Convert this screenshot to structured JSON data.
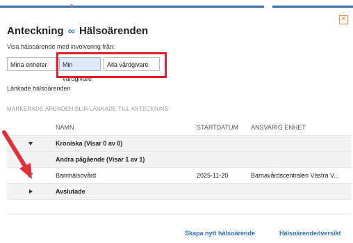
{
  "dialog": {
    "title_left": "Anteckning",
    "title_right": "Hälsoärenden",
    "close_symbol": "✕",
    "filter_label": "Visa hälsoärende med involvering från:",
    "filter_options": [
      "Mina enheter",
      "Min vårdgivare",
      "Alla vårdgivare"
    ],
    "filter_selected": "Min vårdgivare",
    "linked_label": "Länkade hälsoärenden",
    "marked_note": "MARKERADE ÄRENDEN BLIR LÄNKADE TILL ANTECKNING"
  },
  "table": {
    "columns": [
      "NAMN",
      "STARTDATUM",
      "ANSVARIG ENHET"
    ],
    "groups": [
      {
        "label": "Kroniska (Visar 0 av 0)",
        "expanded": true,
        "rows": []
      },
      {
        "label": "Andra pågående (Visar 1 av 1)",
        "expanded": true,
        "rows": [
          {
            "checked": true,
            "name": "Barnhälsovård",
            "start": "2025-11-20",
            "unit": "Barnavårdscentralen Västra V..."
          }
        ]
      },
      {
        "label": "Avslutade",
        "expanded": false,
        "rows": []
      }
    ]
  },
  "footer": {
    "create_link": "Skapa nytt hälsoärende",
    "overview_link": "Hälsoärendeöversikt"
  },
  "colors": {
    "accent": "#2a6fc0",
    "highlight": "#e0202a",
    "close": "#e48a4a"
  },
  "icons": {
    "link": "infinity-link-icon",
    "close": "close-icon",
    "check": "check-icon",
    "expand": "chevron-down-icon",
    "collapse": "chevron-right-icon"
  }
}
